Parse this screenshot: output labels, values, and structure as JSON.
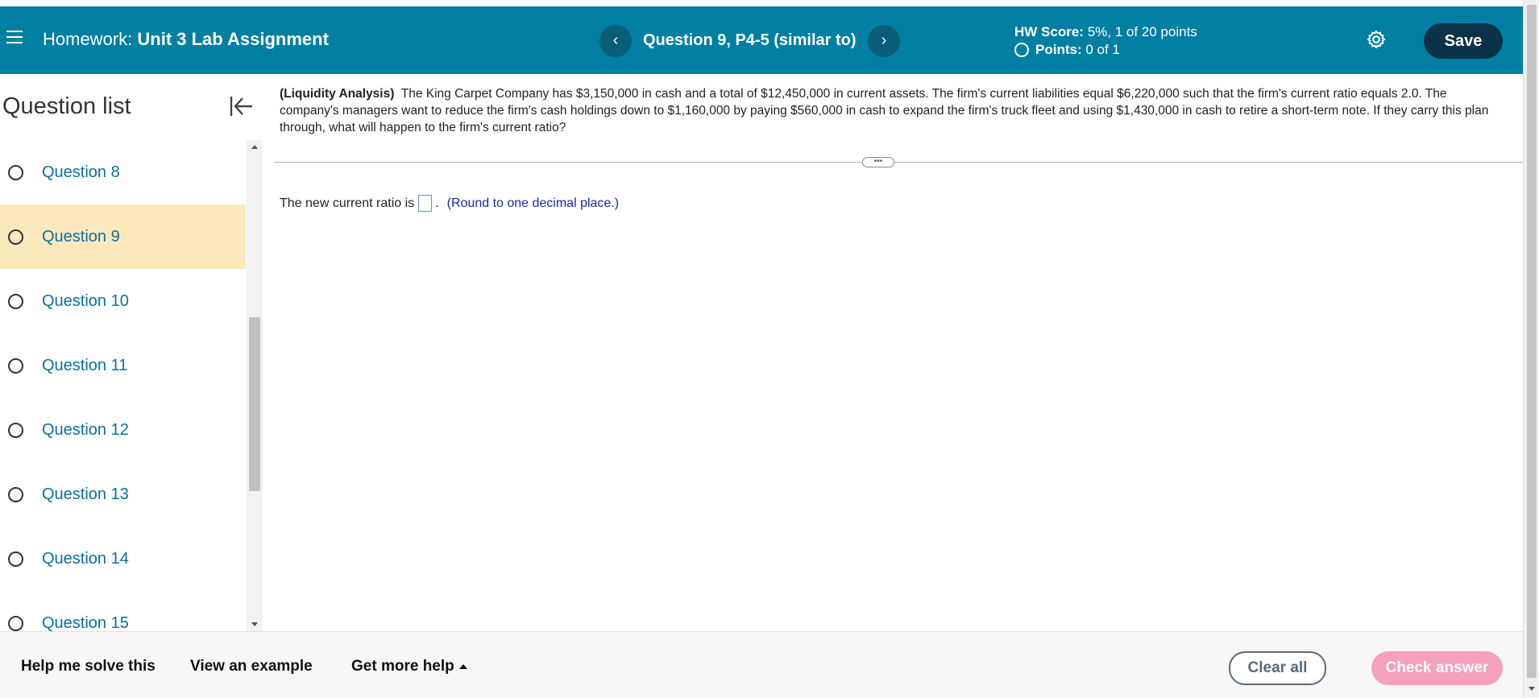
{
  "header": {
    "title_prefix": "Homework:",
    "title_name": "Unit 3 Lab Assignment",
    "question_title": "Question 9, P4-5 (similar to)",
    "prev_glyph": "‹",
    "next_glyph": "›",
    "hw_score_label": "HW Score:",
    "hw_score_value": "5%, 1 of 20 points",
    "points_label": "Points:",
    "points_value": "0 of 1",
    "save_label": "Save",
    "colors": {
      "bar": "#007fa3",
      "save": "#0b3248"
    },
    "icons": {
      "menu": "hamburger-menu-icon",
      "settings": "gear-icon"
    }
  },
  "sidebar": {
    "title": "Question list",
    "collapse_icon": "collapse-left-icon",
    "items": [
      {
        "label": "Question 8",
        "active": false
      },
      {
        "label": "Question 9",
        "active": true
      },
      {
        "label": "Question 10",
        "active": false
      },
      {
        "label": "Question 11",
        "active": false
      },
      {
        "label": "Question 12",
        "active": false
      },
      {
        "label": "Question 13",
        "active": false
      },
      {
        "label": "Question 14",
        "active": false
      },
      {
        "label": "Question 15",
        "active": false
      }
    ]
  },
  "problem": {
    "topic": "(Liquidity Analysis)",
    "text": "The King Carpet Company has $3,150,000 in cash and a total of $12,450,000 in current assets.  The firm's current liabilities equal $6,220,000 such that the firm's current ratio equals 2.0.  The company's managers want to reduce the firm's cash holdings down to $1,160,000 by paying $560,000 in cash to expand the firm's truck fleet and using $1,430,000 in cash to retire a short-term note.  If they carry this plan through, what will happen to the firm's current ratio?",
    "divider_handle": "•••",
    "answer_prompt": "The new current ratio is",
    "answer_value": "",
    "answer_period": ".",
    "hint": "(Round to one decimal place.)"
  },
  "footer": {
    "help_solve": "Help me solve this",
    "view_example": "View an example",
    "more_help": "Get more help",
    "clear_all": "Clear all",
    "check_answer": "Check answer",
    "colors": {
      "check": "#f5a0bd",
      "clear_border": "#5a6a7a"
    }
  }
}
